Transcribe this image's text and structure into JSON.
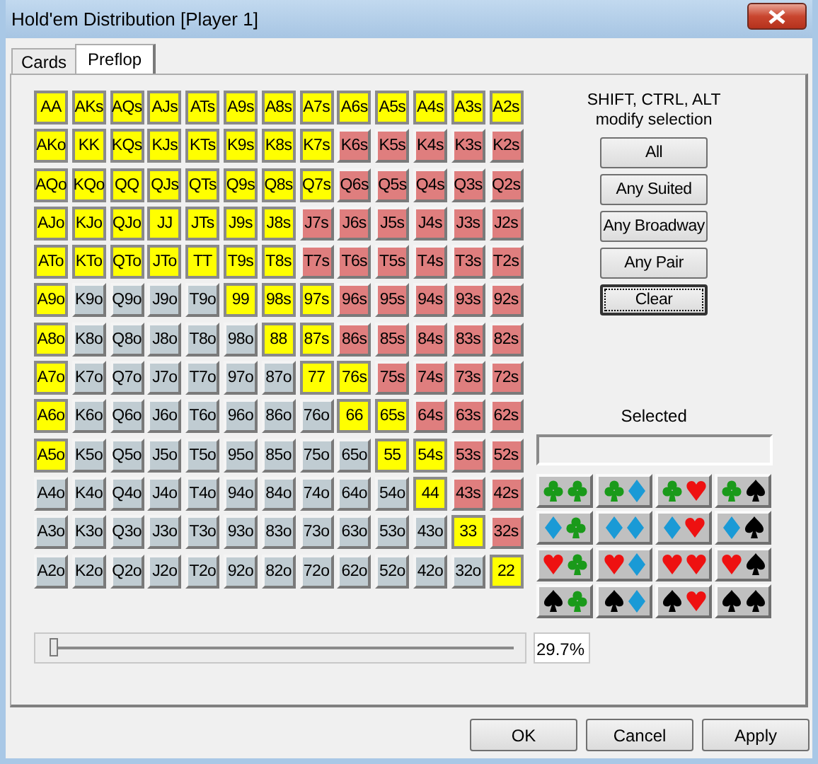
{
  "window": {
    "title": "Hold'em Distribution [Player 1]"
  },
  "tabs": [
    {
      "label": "Cards",
      "selected": false
    },
    {
      "label": "Preflop",
      "selected": true
    }
  ],
  "grid": [
    [
      {
        "label": "AA",
        "kind": "pair",
        "selected": true
      },
      {
        "label": "AKs",
        "kind": "suited",
        "selected": true
      },
      {
        "label": "AQs",
        "kind": "suited",
        "selected": true
      },
      {
        "label": "AJs",
        "kind": "suited",
        "selected": true
      },
      {
        "label": "ATs",
        "kind": "suited",
        "selected": true
      },
      {
        "label": "A9s",
        "kind": "suited",
        "selected": true
      },
      {
        "label": "A8s",
        "kind": "suited",
        "selected": true
      },
      {
        "label": "A7s",
        "kind": "suited",
        "selected": true
      },
      {
        "label": "A6s",
        "kind": "suited",
        "selected": true
      },
      {
        "label": "A5s",
        "kind": "suited",
        "selected": true
      },
      {
        "label": "A4s",
        "kind": "suited",
        "selected": true
      },
      {
        "label": "A3s",
        "kind": "suited",
        "selected": true
      },
      {
        "label": "A2s",
        "kind": "suited",
        "selected": true
      }
    ],
    [
      {
        "label": "AKo",
        "kind": "offsuit",
        "selected": true
      },
      {
        "label": "KK",
        "kind": "pair",
        "selected": true
      },
      {
        "label": "KQs",
        "kind": "suited",
        "selected": true
      },
      {
        "label": "KJs",
        "kind": "suited",
        "selected": true
      },
      {
        "label": "KTs",
        "kind": "suited",
        "selected": true
      },
      {
        "label": "K9s",
        "kind": "suited",
        "selected": true
      },
      {
        "label": "K8s",
        "kind": "suited",
        "selected": true
      },
      {
        "label": "K7s",
        "kind": "suited",
        "selected": true
      },
      {
        "label": "K6s",
        "kind": "suited",
        "selected": false
      },
      {
        "label": "K5s",
        "kind": "suited",
        "selected": false
      },
      {
        "label": "K4s",
        "kind": "suited",
        "selected": false
      },
      {
        "label": "K3s",
        "kind": "suited",
        "selected": false
      },
      {
        "label": "K2s",
        "kind": "suited",
        "selected": false
      }
    ],
    [
      {
        "label": "AQo",
        "kind": "offsuit",
        "selected": true
      },
      {
        "label": "KQo",
        "kind": "offsuit",
        "selected": true
      },
      {
        "label": "QQ",
        "kind": "pair",
        "selected": true
      },
      {
        "label": "QJs",
        "kind": "suited",
        "selected": true
      },
      {
        "label": "QTs",
        "kind": "suited",
        "selected": true
      },
      {
        "label": "Q9s",
        "kind": "suited",
        "selected": true
      },
      {
        "label": "Q8s",
        "kind": "suited",
        "selected": true
      },
      {
        "label": "Q7s",
        "kind": "suited",
        "selected": true
      },
      {
        "label": "Q6s",
        "kind": "suited",
        "selected": false
      },
      {
        "label": "Q5s",
        "kind": "suited",
        "selected": false
      },
      {
        "label": "Q4s",
        "kind": "suited",
        "selected": false
      },
      {
        "label": "Q3s",
        "kind": "suited",
        "selected": false
      },
      {
        "label": "Q2s",
        "kind": "suited",
        "selected": false
      }
    ],
    [
      {
        "label": "AJo",
        "kind": "offsuit",
        "selected": true
      },
      {
        "label": "KJo",
        "kind": "offsuit",
        "selected": true
      },
      {
        "label": "QJo",
        "kind": "offsuit",
        "selected": true
      },
      {
        "label": "JJ",
        "kind": "pair",
        "selected": true
      },
      {
        "label": "JTs",
        "kind": "suited",
        "selected": true
      },
      {
        "label": "J9s",
        "kind": "suited",
        "selected": true
      },
      {
        "label": "J8s",
        "kind": "suited",
        "selected": true
      },
      {
        "label": "J7s",
        "kind": "suited",
        "selected": false
      },
      {
        "label": "J6s",
        "kind": "suited",
        "selected": false
      },
      {
        "label": "J5s",
        "kind": "suited",
        "selected": false
      },
      {
        "label": "J4s",
        "kind": "suited",
        "selected": false
      },
      {
        "label": "J3s",
        "kind": "suited",
        "selected": false
      },
      {
        "label": "J2s",
        "kind": "suited",
        "selected": false
      }
    ],
    [
      {
        "label": "ATo",
        "kind": "offsuit",
        "selected": true
      },
      {
        "label": "KTo",
        "kind": "offsuit",
        "selected": true
      },
      {
        "label": "QTo",
        "kind": "offsuit",
        "selected": true
      },
      {
        "label": "JTo",
        "kind": "offsuit",
        "selected": true
      },
      {
        "label": "TT",
        "kind": "pair",
        "selected": true
      },
      {
        "label": "T9s",
        "kind": "suited",
        "selected": true
      },
      {
        "label": "T8s",
        "kind": "suited",
        "selected": true
      },
      {
        "label": "T7s",
        "kind": "suited",
        "selected": false
      },
      {
        "label": "T6s",
        "kind": "suited",
        "selected": false
      },
      {
        "label": "T5s",
        "kind": "suited",
        "selected": false
      },
      {
        "label": "T4s",
        "kind": "suited",
        "selected": false
      },
      {
        "label": "T3s",
        "kind": "suited",
        "selected": false
      },
      {
        "label": "T2s",
        "kind": "suited",
        "selected": false
      }
    ],
    [
      {
        "label": "A9o",
        "kind": "offsuit",
        "selected": true
      },
      {
        "label": "K9o",
        "kind": "offsuit",
        "selected": false
      },
      {
        "label": "Q9o",
        "kind": "offsuit",
        "selected": false
      },
      {
        "label": "J9o",
        "kind": "offsuit",
        "selected": false
      },
      {
        "label": "T9o",
        "kind": "offsuit",
        "selected": false
      },
      {
        "label": "99",
        "kind": "pair",
        "selected": true
      },
      {
        "label": "98s",
        "kind": "suited",
        "selected": true
      },
      {
        "label": "97s",
        "kind": "suited",
        "selected": true
      },
      {
        "label": "96s",
        "kind": "suited",
        "selected": false
      },
      {
        "label": "95s",
        "kind": "suited",
        "selected": false
      },
      {
        "label": "94s",
        "kind": "suited",
        "selected": false
      },
      {
        "label": "93s",
        "kind": "suited",
        "selected": false
      },
      {
        "label": "92s",
        "kind": "suited",
        "selected": false
      }
    ],
    [
      {
        "label": "A8o",
        "kind": "offsuit",
        "selected": true
      },
      {
        "label": "K8o",
        "kind": "offsuit",
        "selected": false
      },
      {
        "label": "Q8o",
        "kind": "offsuit",
        "selected": false
      },
      {
        "label": "J8o",
        "kind": "offsuit",
        "selected": false
      },
      {
        "label": "T8o",
        "kind": "offsuit",
        "selected": false
      },
      {
        "label": "98o",
        "kind": "offsuit",
        "selected": false
      },
      {
        "label": "88",
        "kind": "pair",
        "selected": true
      },
      {
        "label": "87s",
        "kind": "suited",
        "selected": true
      },
      {
        "label": "86s",
        "kind": "suited",
        "selected": false
      },
      {
        "label": "85s",
        "kind": "suited",
        "selected": false
      },
      {
        "label": "84s",
        "kind": "suited",
        "selected": false
      },
      {
        "label": "83s",
        "kind": "suited",
        "selected": false
      },
      {
        "label": "82s",
        "kind": "suited",
        "selected": false
      }
    ],
    [
      {
        "label": "A7o",
        "kind": "offsuit",
        "selected": true
      },
      {
        "label": "K7o",
        "kind": "offsuit",
        "selected": false
      },
      {
        "label": "Q7o",
        "kind": "offsuit",
        "selected": false
      },
      {
        "label": "J7o",
        "kind": "offsuit",
        "selected": false
      },
      {
        "label": "T7o",
        "kind": "offsuit",
        "selected": false
      },
      {
        "label": "97o",
        "kind": "offsuit",
        "selected": false
      },
      {
        "label": "87o",
        "kind": "offsuit",
        "selected": false
      },
      {
        "label": "77",
        "kind": "pair",
        "selected": true
      },
      {
        "label": "76s",
        "kind": "suited",
        "selected": true
      },
      {
        "label": "75s",
        "kind": "suited",
        "selected": false
      },
      {
        "label": "74s",
        "kind": "suited",
        "selected": false
      },
      {
        "label": "73s",
        "kind": "suited",
        "selected": false
      },
      {
        "label": "72s",
        "kind": "suited",
        "selected": false
      }
    ],
    [
      {
        "label": "A6o",
        "kind": "offsuit",
        "selected": true
      },
      {
        "label": "K6o",
        "kind": "offsuit",
        "selected": false
      },
      {
        "label": "Q6o",
        "kind": "offsuit",
        "selected": false
      },
      {
        "label": "J6o",
        "kind": "offsuit",
        "selected": false
      },
      {
        "label": "T6o",
        "kind": "offsuit",
        "selected": false
      },
      {
        "label": "96o",
        "kind": "offsuit",
        "selected": false
      },
      {
        "label": "86o",
        "kind": "offsuit",
        "selected": false
      },
      {
        "label": "76o",
        "kind": "offsuit",
        "selected": false
      },
      {
        "label": "66",
        "kind": "pair",
        "selected": true
      },
      {
        "label": "65s",
        "kind": "suited",
        "selected": true
      },
      {
        "label": "64s",
        "kind": "suited",
        "selected": false
      },
      {
        "label": "63s",
        "kind": "suited",
        "selected": false
      },
      {
        "label": "62s",
        "kind": "suited",
        "selected": false
      }
    ],
    [
      {
        "label": "A5o",
        "kind": "offsuit",
        "selected": true
      },
      {
        "label": "K5o",
        "kind": "offsuit",
        "selected": false
      },
      {
        "label": "Q5o",
        "kind": "offsuit",
        "selected": false
      },
      {
        "label": "J5o",
        "kind": "offsuit",
        "selected": false
      },
      {
        "label": "T5o",
        "kind": "offsuit",
        "selected": false
      },
      {
        "label": "95o",
        "kind": "offsuit",
        "selected": false
      },
      {
        "label": "85o",
        "kind": "offsuit",
        "selected": false
      },
      {
        "label": "75o",
        "kind": "offsuit",
        "selected": false
      },
      {
        "label": "65o",
        "kind": "offsuit",
        "selected": false
      },
      {
        "label": "55",
        "kind": "pair",
        "selected": true
      },
      {
        "label": "54s",
        "kind": "suited",
        "selected": true
      },
      {
        "label": "53s",
        "kind": "suited",
        "selected": false
      },
      {
        "label": "52s",
        "kind": "suited",
        "selected": false
      }
    ],
    [
      {
        "label": "A4o",
        "kind": "offsuit",
        "selected": false
      },
      {
        "label": "K4o",
        "kind": "offsuit",
        "selected": false
      },
      {
        "label": "Q4o",
        "kind": "offsuit",
        "selected": false
      },
      {
        "label": "J4o",
        "kind": "offsuit",
        "selected": false
      },
      {
        "label": "T4o",
        "kind": "offsuit",
        "selected": false
      },
      {
        "label": "94o",
        "kind": "offsuit",
        "selected": false
      },
      {
        "label": "84o",
        "kind": "offsuit",
        "selected": false
      },
      {
        "label": "74o",
        "kind": "offsuit",
        "selected": false
      },
      {
        "label": "64o",
        "kind": "offsuit",
        "selected": false
      },
      {
        "label": "54o",
        "kind": "offsuit",
        "selected": false
      },
      {
        "label": "44",
        "kind": "pair",
        "selected": true
      },
      {
        "label": "43s",
        "kind": "suited",
        "selected": false
      },
      {
        "label": "42s",
        "kind": "suited",
        "selected": false
      }
    ],
    [
      {
        "label": "A3o",
        "kind": "offsuit",
        "selected": false
      },
      {
        "label": "K3o",
        "kind": "offsuit",
        "selected": false
      },
      {
        "label": "Q3o",
        "kind": "offsuit",
        "selected": false
      },
      {
        "label": "J3o",
        "kind": "offsuit",
        "selected": false
      },
      {
        "label": "T3o",
        "kind": "offsuit",
        "selected": false
      },
      {
        "label": "93o",
        "kind": "offsuit",
        "selected": false
      },
      {
        "label": "83o",
        "kind": "offsuit",
        "selected": false
      },
      {
        "label": "73o",
        "kind": "offsuit",
        "selected": false
      },
      {
        "label": "63o",
        "kind": "offsuit",
        "selected": false
      },
      {
        "label": "53o",
        "kind": "offsuit",
        "selected": false
      },
      {
        "label": "43o",
        "kind": "offsuit",
        "selected": false
      },
      {
        "label": "33",
        "kind": "pair",
        "selected": true
      },
      {
        "label": "32s",
        "kind": "suited",
        "selected": false
      }
    ],
    [
      {
        "label": "A2o",
        "kind": "offsuit",
        "selected": false
      },
      {
        "label": "K2o",
        "kind": "offsuit",
        "selected": false
      },
      {
        "label": "Q2o",
        "kind": "offsuit",
        "selected": false
      },
      {
        "label": "J2o",
        "kind": "offsuit",
        "selected": false
      },
      {
        "label": "T2o",
        "kind": "offsuit",
        "selected": false
      },
      {
        "label": "92o",
        "kind": "offsuit",
        "selected": false
      },
      {
        "label": "82o",
        "kind": "offsuit",
        "selected": false
      },
      {
        "label": "72o",
        "kind": "offsuit",
        "selected": false
      },
      {
        "label": "62o",
        "kind": "offsuit",
        "selected": false
      },
      {
        "label": "52o",
        "kind": "offsuit",
        "selected": false
      },
      {
        "label": "42o",
        "kind": "offsuit",
        "selected": false
      },
      {
        "label": "32o",
        "kind": "offsuit",
        "selected": false
      },
      {
        "label": "22",
        "kind": "pair",
        "selected": true
      }
    ]
  ],
  "hint": [
    "SHIFT, CTRL, ALT",
    "modify selection"
  ],
  "selection_buttons": [
    {
      "label": "All",
      "focused": false
    },
    {
      "label": "Any Suited",
      "focused": false
    },
    {
      "label": "Any Broadway",
      "focused": false
    },
    {
      "label": "Any Pair",
      "focused": false
    },
    {
      "label": "Clear",
      "focused": true
    }
  ],
  "selected_label": "Selected",
  "slider": {
    "level": 0.01,
    "reading": "29.7%"
  },
  "buttons": [
    "OK",
    "Cancel",
    "Apply"
  ]
}
